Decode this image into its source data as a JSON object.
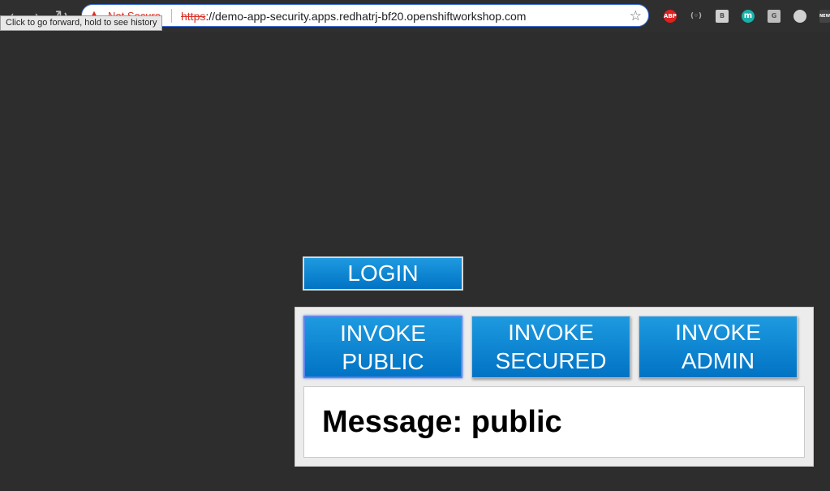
{
  "browser": {
    "back_icon": "‹",
    "forward_icon": "›",
    "reload_icon": "↻",
    "security_icon": "warning-triangle-icon",
    "security_warning_glyph": "▲",
    "security_label": "Not Secure",
    "url_scheme": "https",
    "url_rest": "://demo-app-security.apps.redhatrj-bf20.openshiftworkshop.com",
    "bookmark_icon": "☆",
    "tooltip": "Click to go forward, hold to see history",
    "extensions": [
      {
        "name": "adblock-plus-icon",
        "label": "ABP"
      },
      {
        "name": "lens-extension-icon",
        "label": "(◦)"
      },
      {
        "name": "b-extension-icon",
        "label": "B"
      },
      {
        "name": "m-extension-icon",
        "label": "m"
      },
      {
        "name": "g-extension-icon",
        "label": "G"
      },
      {
        "name": "circle-extension-icon",
        "label": ""
      },
      {
        "name": "news-extension-icon",
        "label": "NEW"
      }
    ]
  },
  "page": {
    "login_label": "LOGIN",
    "buttons": {
      "public": [
        "INVOKE",
        "PUBLIC"
      ],
      "secured": [
        "INVOKE",
        "SECURED"
      ],
      "admin": [
        "INVOKE",
        "ADMIN"
      ]
    },
    "message": "Message: public"
  },
  "colors": {
    "background": "#2d2d2d",
    "button_blue": "#0a86d2",
    "panel": "#ececec",
    "warning_red": "#d93025"
  }
}
